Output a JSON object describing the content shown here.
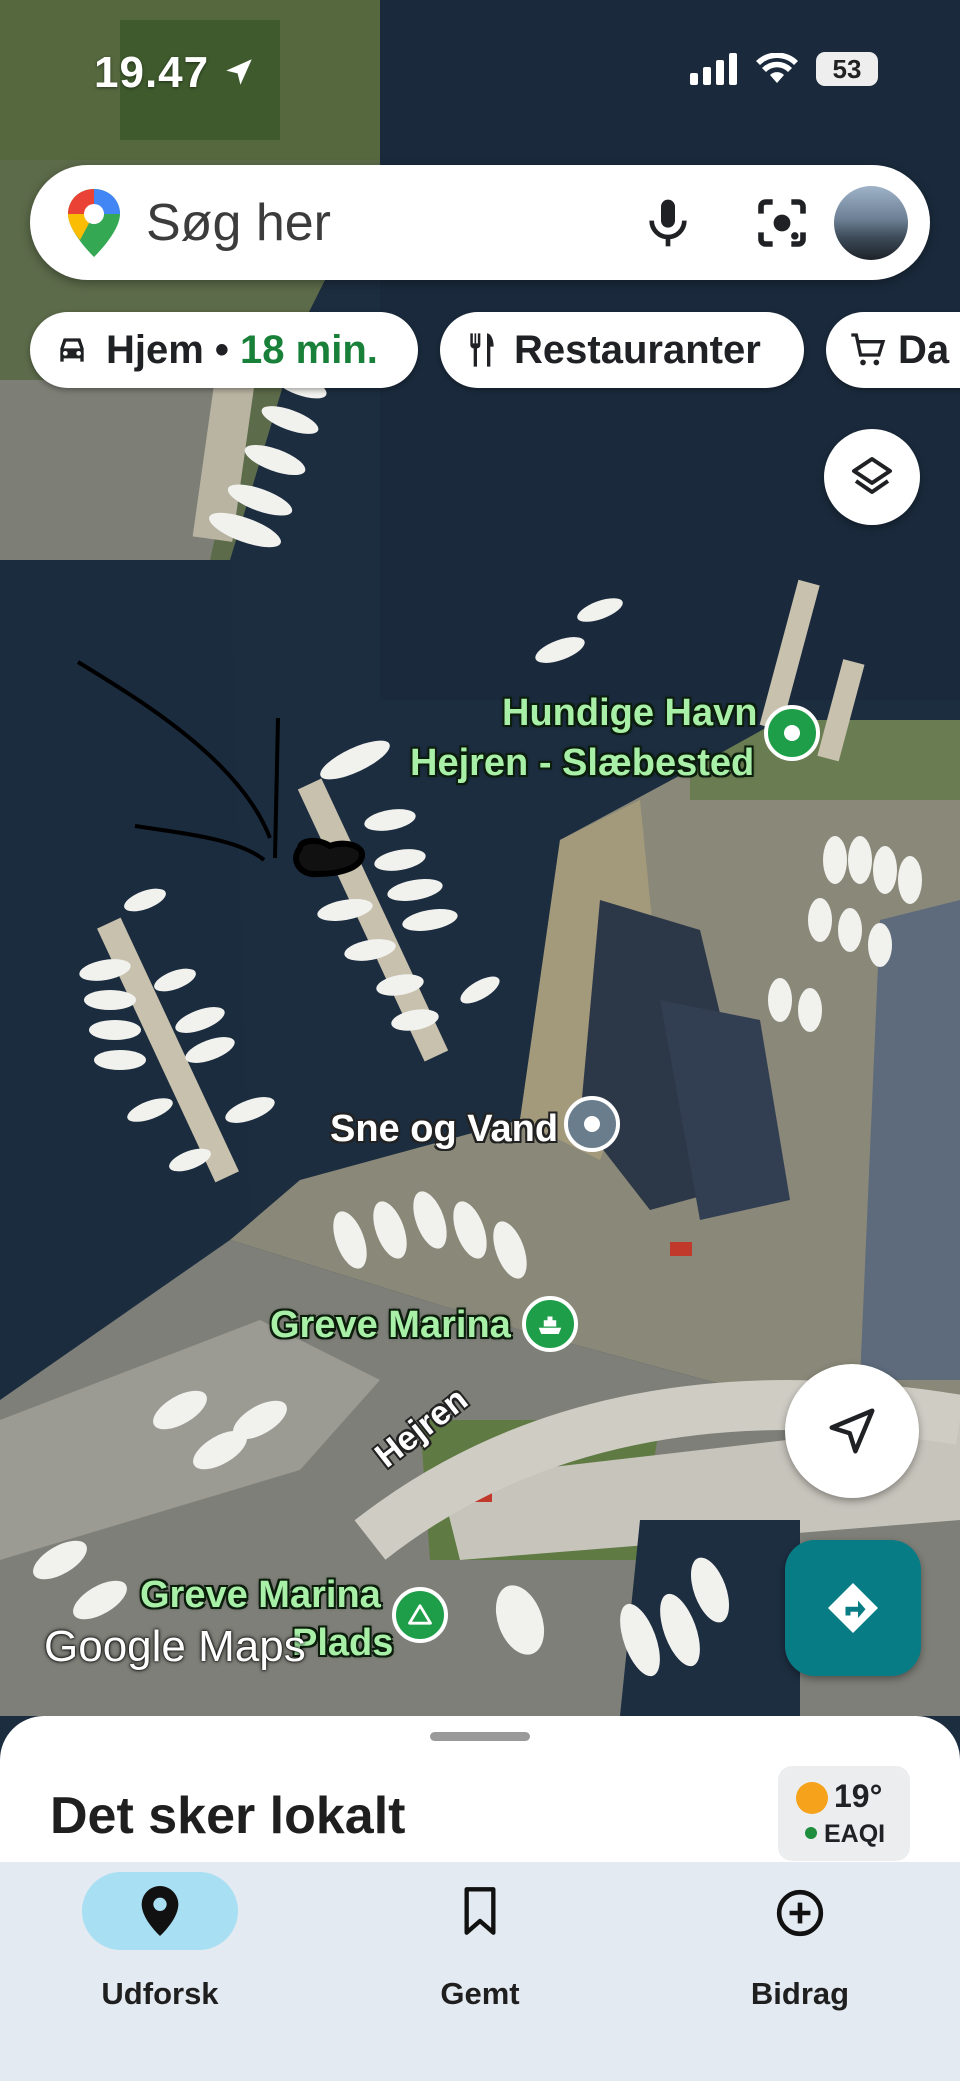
{
  "status_bar": {
    "time": "19.47",
    "battery": "53"
  },
  "search": {
    "placeholder": "Søg her"
  },
  "chips": [
    {
      "label": "Hjem",
      "separator": " • ",
      "eta": "18 min."
    },
    {
      "label": "Restauranter"
    },
    {
      "label": "Da"
    }
  ],
  "map": {
    "labels": {
      "hundige_havn": "Hundige Havn",
      "hejren_slaebested": "Hejren - Slæbested",
      "sne_og_vand": "Sne og Vand",
      "greve_marina": "Greve Marina",
      "greve_marina_plads_line1": "Greve Marina",
      "greve_marina_plads_line2": "Plads",
      "road_hejren": "Hejren"
    },
    "watermark": "Google Maps"
  },
  "sheet": {
    "title": "Det sker lokalt",
    "weather": {
      "temperature": "19°",
      "air_quality": "EAQI",
      "air_quality_color": "#1e8e3e"
    }
  },
  "nav": {
    "items": [
      {
        "label": "Udforsk",
        "active": true
      },
      {
        "label": "Gemt",
        "active": false
      },
      {
        "label": "Bidrag",
        "active": false
      }
    ]
  },
  "colors": {
    "accent_green": "#188038",
    "directions_teal": "#087c85",
    "active_pill": "#a8dff3"
  }
}
